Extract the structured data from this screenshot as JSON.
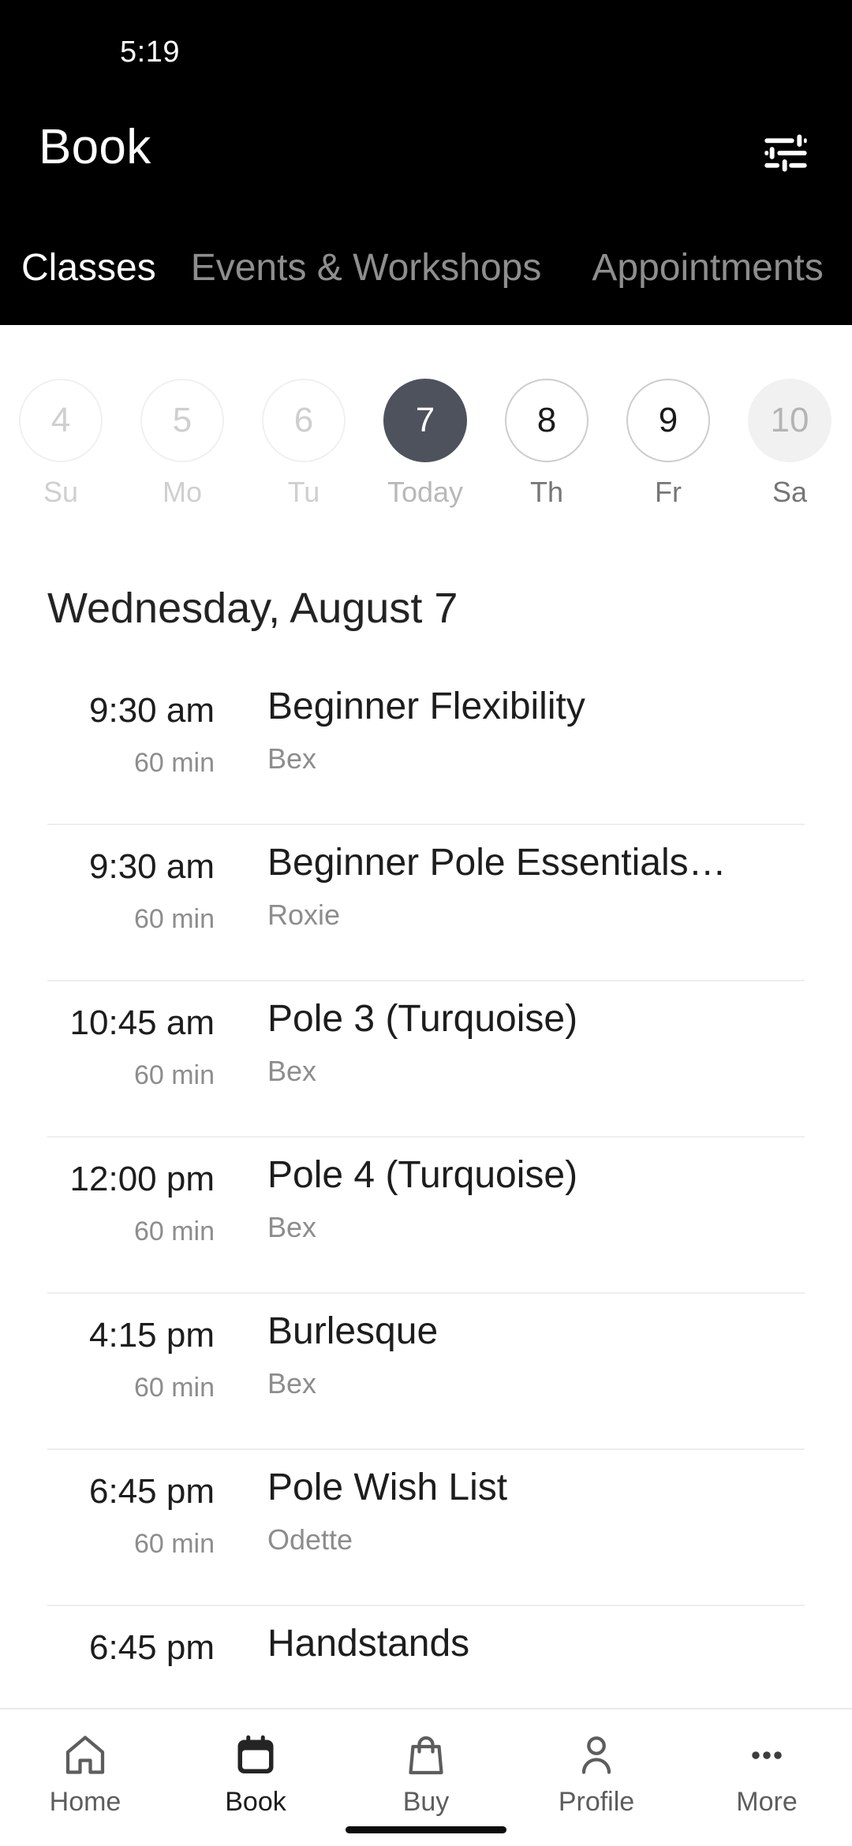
{
  "status_bar": {
    "time": "5:19"
  },
  "header": {
    "title": "Book",
    "filter_icon": "tune-sliders-icon",
    "background_color": "#000000"
  },
  "tabs": [
    {
      "label": "Classes",
      "active": true
    },
    {
      "label": "Events & Workshops",
      "active": false
    },
    {
      "label": "Appointments",
      "active": false
    }
  ],
  "date_strip": {
    "days": [
      {
        "num": "4",
        "label": "Su",
        "state": "past"
      },
      {
        "num": "5",
        "label": "Mo",
        "state": "past"
      },
      {
        "num": "6",
        "label": "Tu",
        "state": "past"
      },
      {
        "num": "7",
        "label": "Today",
        "state": "today"
      },
      {
        "num": "8",
        "label": "Th",
        "state": "future"
      },
      {
        "num": "9",
        "label": "Fr",
        "state": "future"
      },
      {
        "num": "10",
        "label": "Sa",
        "state": "filled"
      }
    ],
    "selected_color": "#4e525c"
  },
  "day_heading": "Wednesday, August 7",
  "classes": [
    {
      "time": "9:30 am",
      "duration": "60 min",
      "title": "Beginner Flexibility",
      "instructor": "Bex"
    },
    {
      "time": "9:30 am",
      "duration": "60 min",
      "title": "Beginner Pole Essentials…",
      "instructor": "Roxie"
    },
    {
      "time": "10:45 am",
      "duration": "60 min",
      "title": "Pole 3 (Turquoise)",
      "instructor": "Bex"
    },
    {
      "time": "12:00 pm",
      "duration": "60 min",
      "title": "Pole 4 (Turquoise)",
      "instructor": "Bex"
    },
    {
      "time": "4:15 pm",
      "duration": "60 min",
      "title": "Burlesque",
      "instructor": "Bex"
    },
    {
      "time": "6:45 pm",
      "duration": "60 min",
      "title": "Pole Wish List",
      "instructor": "Odette"
    },
    {
      "time": "6:45 pm",
      "duration": "",
      "title": "Handstands",
      "instructor": ""
    }
  ],
  "bottom_nav": [
    {
      "label": "Home",
      "icon": "home-icon",
      "active": false
    },
    {
      "label": "Book",
      "icon": "calendar-icon",
      "active": true
    },
    {
      "label": "Buy",
      "icon": "shopping-bag-icon",
      "active": false
    },
    {
      "label": "Profile",
      "icon": "person-icon",
      "active": false
    },
    {
      "label": "More",
      "icon": "ellipsis-icon",
      "active": false
    }
  ]
}
